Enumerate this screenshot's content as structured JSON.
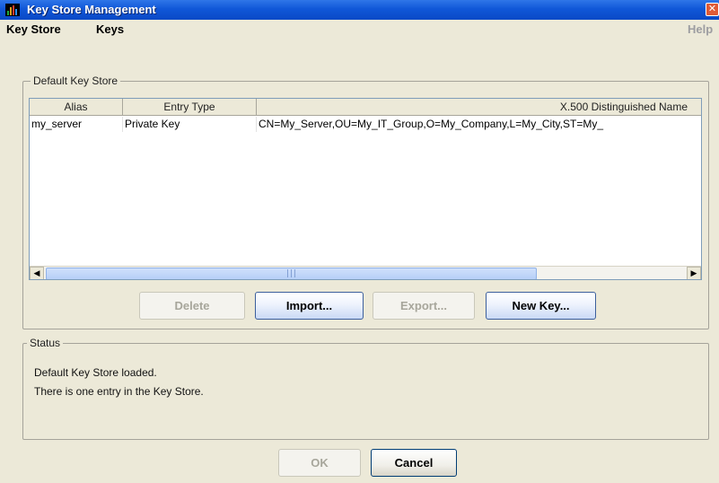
{
  "window": {
    "title": "Key Store Management",
    "close_glyph": "✕"
  },
  "menu": {
    "key_store": "Key Store",
    "keys": "Keys",
    "help": "Help"
  },
  "key_store_group": {
    "label": "Default Key Store",
    "columns": [
      "Alias",
      "Entry Type",
      "X.500 Distinguished Name"
    ],
    "rows": [
      {
        "alias": "my_server",
        "entry_type": "Private Key",
        "dn": "CN=My_Server,OU=My_IT_Group,O=My_Company,L=My_City,ST=My_"
      }
    ],
    "scroll_left_glyph": "◀",
    "scroll_right_glyph": "▶",
    "scroll_grip": "|||",
    "buttons": {
      "delete": "Delete",
      "import": "Import...",
      "export": "Export...",
      "new_key": "New Key..."
    }
  },
  "status_group": {
    "label": "Status",
    "lines": [
      "Default Key Store loaded.",
      "There is one entry in the Key Store."
    ]
  },
  "footer": {
    "ok": "OK",
    "cancel": "Cancel"
  },
  "colors": {
    "title_bar": "#1057d8",
    "dialog_bg": "#ece9d8",
    "scroll_thumb": "#c9dcfa"
  },
  "icons": {
    "app": "key-store-app-icon",
    "close": "close-icon"
  }
}
